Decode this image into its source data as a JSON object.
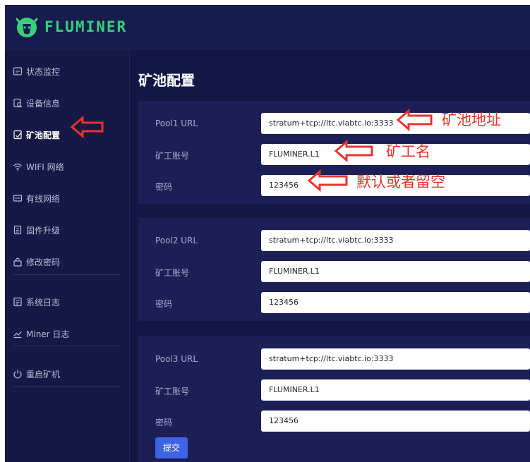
{
  "app": {
    "logo_text": "FLUMINER",
    "brand_color": "#38d07a",
    "background": "#141746"
  },
  "sidebar": {
    "items": [
      {
        "icon": "monitor-icon",
        "label": "状态监控"
      },
      {
        "icon": "device-info-icon",
        "label": "设备信息"
      },
      {
        "icon": "pool-config-icon",
        "label": "矿池配置",
        "active": true
      },
      {
        "icon": "wifi-icon",
        "label": "WIFI 网络"
      },
      {
        "icon": "ethernet-icon",
        "label": "有线网络"
      },
      {
        "icon": "firmware-icon",
        "label": "固件升级"
      },
      {
        "icon": "lock-icon",
        "label": "修改密码"
      },
      {
        "icon": "system-log-icon",
        "label": "系统日志"
      },
      {
        "icon": "chart-icon",
        "label": "Miner 日志"
      },
      {
        "icon": "power-icon",
        "label": "重启矿机"
      }
    ]
  },
  "main": {
    "title": "矿池配置",
    "pools": [
      {
        "url_label": "Pool1 URL",
        "url": "stratum+tcp://ltc.viabtc.io:3333",
        "worker_label": "矿工账号",
        "worker": "FLUMINER.L1",
        "password_label": "密码",
        "password": "123456"
      },
      {
        "url_label": "Pool2 URL",
        "url": "stratum+tcp://ltc.viabtc.io:3333",
        "worker_label": "矿工账号",
        "worker": "FLUMINER.L1",
        "password_label": "密码",
        "password": "123456"
      },
      {
        "url_label": "Pool3 URL",
        "url": "stratum+tcp://ltc.viabtc.io:3333",
        "worker_label": "矿工账号",
        "worker": "FLUMINER.L1",
        "password_label": "密码",
        "password": "123456"
      }
    ],
    "submit_label": "提交"
  },
  "annotations": {
    "pool_address": "矿池地址",
    "worker_name": "矿工名",
    "password_hint": "默认或者留空",
    "color": "#e8342c"
  }
}
